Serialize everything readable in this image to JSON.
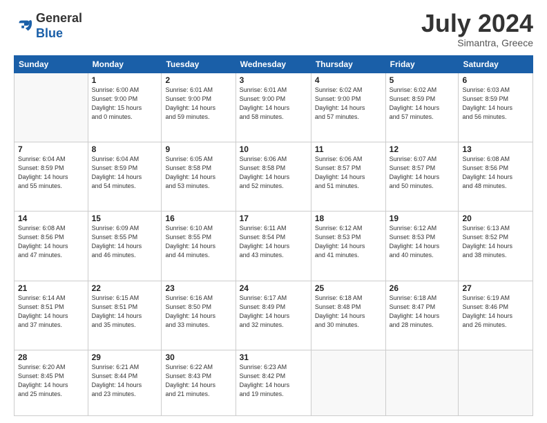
{
  "header": {
    "logo_general": "General",
    "logo_blue": "Blue",
    "month_title": "July 2024",
    "subtitle": "Simantra, Greece"
  },
  "weekdays": [
    "Sunday",
    "Monday",
    "Tuesday",
    "Wednesday",
    "Thursday",
    "Friday",
    "Saturday"
  ],
  "weeks": [
    [
      {
        "day": "",
        "info": ""
      },
      {
        "day": "1",
        "info": "Sunrise: 6:00 AM\nSunset: 9:00 PM\nDaylight: 15 hours\nand 0 minutes."
      },
      {
        "day": "2",
        "info": "Sunrise: 6:01 AM\nSunset: 9:00 PM\nDaylight: 14 hours\nand 59 minutes."
      },
      {
        "day": "3",
        "info": "Sunrise: 6:01 AM\nSunset: 9:00 PM\nDaylight: 14 hours\nand 58 minutes."
      },
      {
        "day": "4",
        "info": "Sunrise: 6:02 AM\nSunset: 9:00 PM\nDaylight: 14 hours\nand 57 minutes."
      },
      {
        "day": "5",
        "info": "Sunrise: 6:02 AM\nSunset: 8:59 PM\nDaylight: 14 hours\nand 57 minutes."
      },
      {
        "day": "6",
        "info": "Sunrise: 6:03 AM\nSunset: 8:59 PM\nDaylight: 14 hours\nand 56 minutes."
      }
    ],
    [
      {
        "day": "7",
        "info": "Sunrise: 6:04 AM\nSunset: 8:59 PM\nDaylight: 14 hours\nand 55 minutes."
      },
      {
        "day": "8",
        "info": "Sunrise: 6:04 AM\nSunset: 8:59 PM\nDaylight: 14 hours\nand 54 minutes."
      },
      {
        "day": "9",
        "info": "Sunrise: 6:05 AM\nSunset: 8:58 PM\nDaylight: 14 hours\nand 53 minutes."
      },
      {
        "day": "10",
        "info": "Sunrise: 6:06 AM\nSunset: 8:58 PM\nDaylight: 14 hours\nand 52 minutes."
      },
      {
        "day": "11",
        "info": "Sunrise: 6:06 AM\nSunset: 8:57 PM\nDaylight: 14 hours\nand 51 minutes."
      },
      {
        "day": "12",
        "info": "Sunrise: 6:07 AM\nSunset: 8:57 PM\nDaylight: 14 hours\nand 50 minutes."
      },
      {
        "day": "13",
        "info": "Sunrise: 6:08 AM\nSunset: 8:56 PM\nDaylight: 14 hours\nand 48 minutes."
      }
    ],
    [
      {
        "day": "14",
        "info": "Sunrise: 6:08 AM\nSunset: 8:56 PM\nDaylight: 14 hours\nand 47 minutes."
      },
      {
        "day": "15",
        "info": "Sunrise: 6:09 AM\nSunset: 8:55 PM\nDaylight: 14 hours\nand 46 minutes."
      },
      {
        "day": "16",
        "info": "Sunrise: 6:10 AM\nSunset: 8:55 PM\nDaylight: 14 hours\nand 44 minutes."
      },
      {
        "day": "17",
        "info": "Sunrise: 6:11 AM\nSunset: 8:54 PM\nDaylight: 14 hours\nand 43 minutes."
      },
      {
        "day": "18",
        "info": "Sunrise: 6:12 AM\nSunset: 8:53 PM\nDaylight: 14 hours\nand 41 minutes."
      },
      {
        "day": "19",
        "info": "Sunrise: 6:12 AM\nSunset: 8:53 PM\nDaylight: 14 hours\nand 40 minutes."
      },
      {
        "day": "20",
        "info": "Sunrise: 6:13 AM\nSunset: 8:52 PM\nDaylight: 14 hours\nand 38 minutes."
      }
    ],
    [
      {
        "day": "21",
        "info": "Sunrise: 6:14 AM\nSunset: 8:51 PM\nDaylight: 14 hours\nand 37 minutes."
      },
      {
        "day": "22",
        "info": "Sunrise: 6:15 AM\nSunset: 8:51 PM\nDaylight: 14 hours\nand 35 minutes."
      },
      {
        "day": "23",
        "info": "Sunrise: 6:16 AM\nSunset: 8:50 PM\nDaylight: 14 hours\nand 33 minutes."
      },
      {
        "day": "24",
        "info": "Sunrise: 6:17 AM\nSunset: 8:49 PM\nDaylight: 14 hours\nand 32 minutes."
      },
      {
        "day": "25",
        "info": "Sunrise: 6:18 AM\nSunset: 8:48 PM\nDaylight: 14 hours\nand 30 minutes."
      },
      {
        "day": "26",
        "info": "Sunrise: 6:18 AM\nSunset: 8:47 PM\nDaylight: 14 hours\nand 28 minutes."
      },
      {
        "day": "27",
        "info": "Sunrise: 6:19 AM\nSunset: 8:46 PM\nDaylight: 14 hours\nand 26 minutes."
      }
    ],
    [
      {
        "day": "28",
        "info": "Sunrise: 6:20 AM\nSunset: 8:45 PM\nDaylight: 14 hours\nand 25 minutes."
      },
      {
        "day": "29",
        "info": "Sunrise: 6:21 AM\nSunset: 8:44 PM\nDaylight: 14 hours\nand 23 minutes."
      },
      {
        "day": "30",
        "info": "Sunrise: 6:22 AM\nSunset: 8:43 PM\nDaylight: 14 hours\nand 21 minutes."
      },
      {
        "day": "31",
        "info": "Sunrise: 6:23 AM\nSunset: 8:42 PM\nDaylight: 14 hours\nand 19 minutes."
      },
      {
        "day": "",
        "info": ""
      },
      {
        "day": "",
        "info": ""
      },
      {
        "day": "",
        "info": ""
      }
    ]
  ]
}
